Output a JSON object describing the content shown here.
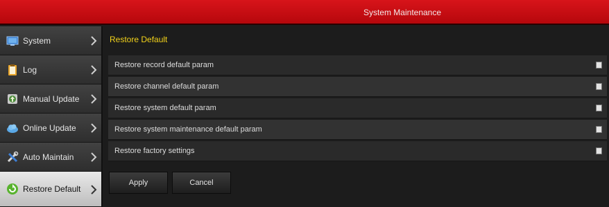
{
  "window": {
    "title": "System Maintenance"
  },
  "colors": {
    "titlebar": "#c80d13",
    "accent_text": "#f2d21a",
    "active_item": "#d6d6d6"
  },
  "sidebar": {
    "items": [
      {
        "label": "System",
        "icon": "monitor-icon",
        "active": false
      },
      {
        "label": "Log",
        "icon": "clipboard-icon",
        "active": false
      },
      {
        "label": "Manual Update",
        "icon": "manual-update-icon",
        "active": false
      },
      {
        "label": "Online Update",
        "icon": "cloud-icon",
        "active": false
      },
      {
        "label": "Auto Maintain",
        "icon": "tools-icon",
        "active": false
      },
      {
        "label": "Restore Default",
        "icon": "restore-icon",
        "active": true
      }
    ]
  },
  "main": {
    "section_title": "Restore Default",
    "options": [
      {
        "label": "Restore record default param",
        "checked": false
      },
      {
        "label": "Restore channel default param",
        "checked": false
      },
      {
        "label": "Restore system default param",
        "checked": false
      },
      {
        "label": "Restore system maintenance default param",
        "checked": false
      },
      {
        "label": "Restore factory settings",
        "checked": false
      }
    ]
  },
  "buttons": {
    "apply": "Apply",
    "cancel": "Cancel"
  }
}
